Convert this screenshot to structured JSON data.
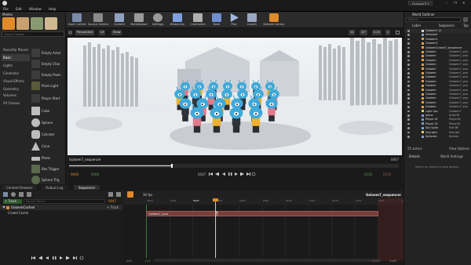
{
  "window": {
    "tab_label": "Golaem7 *",
    "controls": [
      "–",
      "❐",
      "✕"
    ]
  },
  "menu": [
    "File",
    "Edit",
    "Window",
    "Help"
  ],
  "modes": {
    "panel_title": "Modes",
    "search_placeholder": "Search Classes",
    "categories": [
      "Recently Placed",
      "Basic",
      "Lights",
      "Cinematic",
      "Visual Effects",
      "Geometry",
      "Volumes",
      "All Classes"
    ],
    "active_category": "Basic",
    "items": [
      "Empty Actor",
      "Empty Char",
      "Empty Pawn",
      "Point Light",
      "Player Start",
      "Cube",
      "Sphere",
      "Cylinder",
      "Cone",
      "Plane",
      "Box Trigger",
      "Sphere Trig"
    ]
  },
  "toolbar": {
    "buttons": [
      {
        "label": "Save Current",
        "color": "#7a8aa8"
      },
      {
        "label": "Source Control",
        "color": "#8a8a8a"
      },
      {
        "label": "Content",
        "color": "#8fa0c0"
      },
      {
        "label": "Marketplace",
        "color": "#9a9a9a"
      },
      {
        "label": "Settings",
        "color": "#9a9a9a"
      },
      {
        "label": "Blueprints",
        "color": "#7ca0e0"
      },
      {
        "label": "Cinematics",
        "color": "#b0b0b0"
      },
      {
        "label": "Build",
        "color": "#6f8fd0"
      },
      {
        "label": "Play",
        "color": "#a0b8e0"
      },
      {
        "label": "Launch",
        "color": "#9aa8c0"
      },
      {
        "label": "Golaem Library",
        "color": "#e08a2a"
      }
    ]
  },
  "viewport": {
    "view_mode": "Perspective",
    "lit_mode": "Lit",
    "show": "Show",
    "grid_value": "10",
    "rot_value": "10°",
    "scale_value": "0.25",
    "camera_speed": "4",
    "sequence_name": "Golaem7_sequencer",
    "frame_right": "0047",
    "frame_left": "0000",
    "frame_end": "0150",
    "frame_mid": "0047",
    "progress_fraction": 0.31
  },
  "outliner": {
    "panel_title": "World Outliner",
    "search_placeholder": "Search...",
    "col_label": "Label",
    "col_sequence": "Sequence",
    "col_type": "Typ",
    "rows": [
      {
        "label": "Golaem7 (e",
        "seq": "",
        "color": "#d8d8d8"
      },
      {
        "label": "Atmosph",
        "seq": "",
        "color": "#7da0d0"
      },
      {
        "label": "Golaem1",
        "seq": "",
        "color": "#e0a040"
      },
      {
        "label": "Golaem1",
        "seq": "",
        "color": "#e0a040"
      },
      {
        "label": "GolaemCrowd7_sequencer",
        "seq": "",
        "color": "#e0a040"
      },
      {
        "label": "Golaem",
        "seq": "Golaem7_seq",
        "color": "#e0a040"
      },
      {
        "label": "Golaem",
        "seq": "Golaem7_seq",
        "color": "#e0a040"
      },
      {
        "label": "Golaem",
        "seq": "Golaem7_seq",
        "color": "#e0a040"
      },
      {
        "label": "Golaem",
        "seq": "Golaem7_seq",
        "color": "#e0a040"
      },
      {
        "label": "Golaem",
        "seq": "Golaem7_seq",
        "color": "#e0a040"
      },
      {
        "label": "Golaem",
        "seq": "Golaem7_seq",
        "color": "#e0a040"
      },
      {
        "label": "Golaem",
        "seq": "Golaem7_seq",
        "color": "#e0a040"
      },
      {
        "label": "Golaem",
        "seq": "Golaem7_seq",
        "color": "#e0a040"
      },
      {
        "label": "Golaem",
        "seq": "Golaem7_seq",
        "color": "#e0a040"
      },
      {
        "label": "Golaem",
        "seq": "Golaem7_seq",
        "color": "#e0a040"
      },
      {
        "label": "Golaem",
        "seq": "Golaem7_seq",
        "color": "#e0a040"
      },
      {
        "label": "Golaem",
        "seq": "Golaem7_seq",
        "color": "#e0a040"
      },
      {
        "label": "Golaem",
        "seq": "Golaem7_seq",
        "color": "#e0a040"
      },
      {
        "label": "Golaem",
        "seq": "Golaem7_seq",
        "color": "#e0a040"
      },
      {
        "label": "Light Sou",
        "seq": "Golaem7",
        "color": "#e0d060"
      },
      {
        "label": "plane",
        "seq": "StaticM",
        "color": "#7da0d0"
      },
      {
        "label": "Player St",
        "seq": "PlayerSt",
        "color": "#7da0d0"
      },
      {
        "label": "Player St",
        "seq": "PlayerSt",
        "color": "#7da0d0"
      },
      {
        "label": "Sky Sphe",
        "seq": "Edit BP",
        "color": "#7da0d0"
      },
      {
        "label": "SkyLight",
        "seq": "SkyLigh",
        "color": "#e0d060"
      },
      {
        "label": "Sphereb",
        "seq": "Sphere",
        "color": "#7da0d0"
      }
    ],
    "count": "25 actors",
    "view_options": "View Options"
  },
  "details": {
    "tab_details": "Details",
    "tab_world": "World Settings",
    "empty_message": "Select an object to view details."
  },
  "bottom": {
    "tabs": [
      "Content Browser",
      "Output Log",
      "Sequencer"
    ],
    "active_tab": "Sequencer",
    "sequence_title": "Golaem7_sequencer",
    "fps": "30 fps",
    "track_button": "Track",
    "search_placeholder": "Search Tracks",
    "current_frame": "0047",
    "add_button": "Track",
    "tracks": [
      "GolaemCached",
      "Crowd Cache"
    ],
    "section_label": "Golaem7_scus",
    "section_key": "0",
    "ruler_ticks": [
      "0015",
      "0030",
      "0047",
      "0060",
      "0075",
      "0090",
      "0105",
      "0120",
      "0135",
      "0150",
      "0165",
      "0180"
    ],
    "range_left": "-015",
    "range_left2": "-015",
    "range_right": "0165",
    "range_right2": "0150",
    "range_far": "0165"
  },
  "colors": {
    "panel": "#262626",
    "accent_orange": "#e08a2a",
    "selection_blue": "#2d5a8a",
    "section_color": "#7a3d3a"
  }
}
